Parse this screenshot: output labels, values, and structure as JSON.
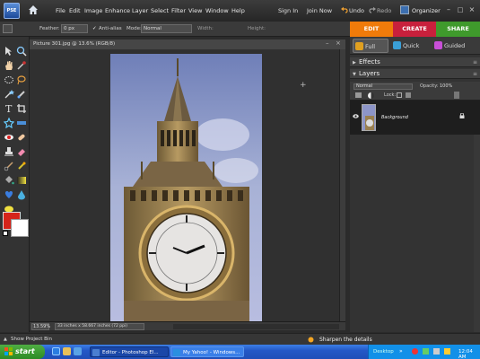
{
  "app": {
    "logo_text": "PSE",
    "menus": [
      "File",
      "Edit",
      "Image",
      "Enhance",
      "Layer",
      "Select",
      "Filter",
      "View",
      "Window",
      "Help"
    ],
    "sign_in": "Sign In",
    "join_now": "Join Now",
    "undo": "Undo",
    "redo": "Redo",
    "organizer": "Organizer"
  },
  "options_bar": {
    "feather_label": "Feather:",
    "feather_value": "0 px",
    "antialias_label": "Anti-alias",
    "mode_label": "Mode:",
    "mode_value": "Normal",
    "width_label": "Width:",
    "height_label": "Height:"
  },
  "mode_tabs": {
    "edit": "EDIT",
    "create": "CREATE",
    "share": "SHARE",
    "edit_color": "#f07b0a",
    "create_color": "#c8203c",
    "share_color": "#3f9a2c"
  },
  "sub_tabs": {
    "full": "Full",
    "quick": "Quick",
    "guided": "Guided"
  },
  "document": {
    "title": "Picture 301.jpg @ 13.6% (RGB/8)",
    "zoom": "13.59%",
    "size": "33 inches x 58.667 inches (72 ppi)"
  },
  "palette": {
    "effects": "Effects",
    "layers": "Layers",
    "blend_mode": "Normal",
    "opacity_label": "Opacity:",
    "opacity_value": "100%",
    "lock_label": "Lock:",
    "layer_name": "Background"
  },
  "bottom": {
    "project_bin": "Show Project Bin",
    "tip": "Sharpen the details"
  },
  "taskbar": {
    "start": "start",
    "tasks": [
      "Editor - Photoshop El...",
      "My Yahoo! - Windows..."
    ],
    "desktop": "Desktop",
    "clock": "12:04 AM"
  },
  "icons": [
    "home-icon",
    "undo-icon",
    "redo-icon",
    "organizer-icon",
    "eye-icon",
    "lock-icon",
    "tip-bulb-icon",
    "windows-flag-icon"
  ]
}
